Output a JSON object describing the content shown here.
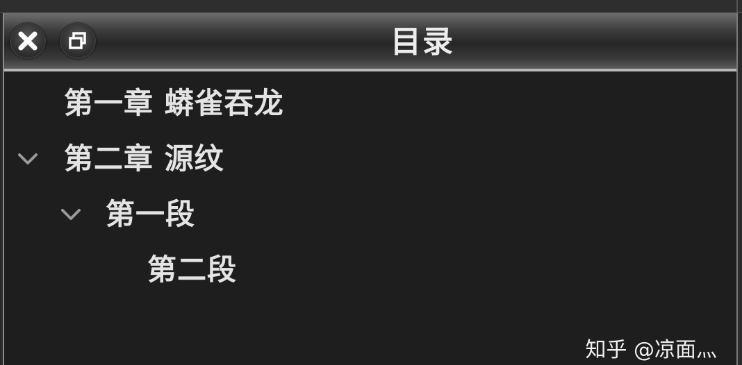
{
  "panel": {
    "title": "目录",
    "close_icon": "close-icon",
    "restore_icon": "restore-window-icon"
  },
  "tree": {
    "items": [
      {
        "label": "第一章 蟒雀吞龙",
        "expanded": false,
        "has_children": false
      },
      {
        "label": "第二章 源纹",
        "expanded": true,
        "has_children": true
      },
      {
        "label": "第一段",
        "expanded": true,
        "has_children": true
      },
      {
        "label": "第二段",
        "expanded": false,
        "has_children": false
      }
    ],
    "chevron_icon": "chevron-down-icon"
  },
  "watermark": {
    "text": "知乎 @凉面灬"
  },
  "colors": {
    "panel_bg": "#1e1e1e",
    "text": "#e4e4e4",
    "chevron": "#9a9a9a",
    "titlebar_border": "#b9b9b9"
  }
}
